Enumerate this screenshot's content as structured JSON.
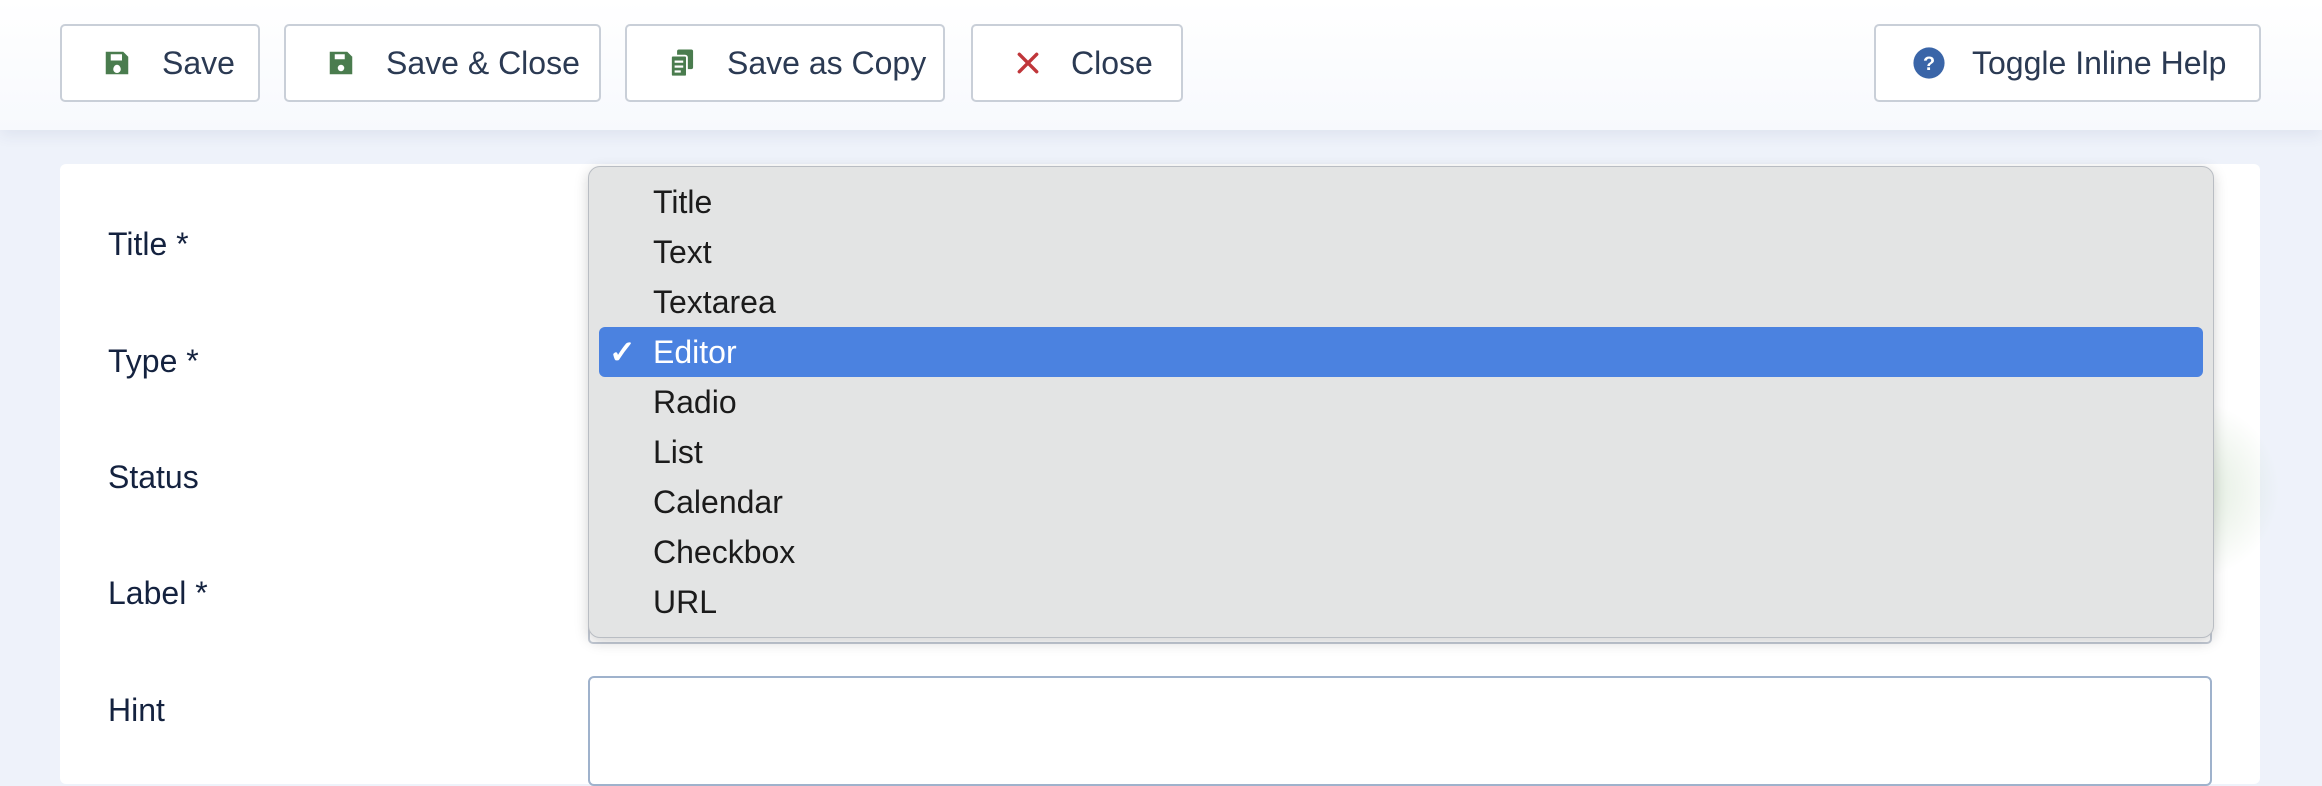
{
  "toolbar": {
    "save_label": "Save",
    "save_close_label": "Save & Close",
    "save_copy_label": "Save as Copy",
    "close_label": "Close",
    "help_label": "Toggle Inline Help"
  },
  "form": {
    "title_label": "Title *",
    "type_label": "Type *",
    "status_label": "Status",
    "label_label": "Label *",
    "hint_label": "Hint"
  },
  "type_dropdown": {
    "options": [
      "Title",
      "Text",
      "Textarea",
      "Editor",
      "Radio",
      "List",
      "Calendar",
      "Checkbox",
      "URL"
    ],
    "selected": "Editor",
    "check_glyph": "✓"
  },
  "colors": {
    "save_icon": "#4a7c4e",
    "close_icon": "#c0363a",
    "help_icon": "#3a65a8",
    "selected_bg": "#4b82e0"
  }
}
